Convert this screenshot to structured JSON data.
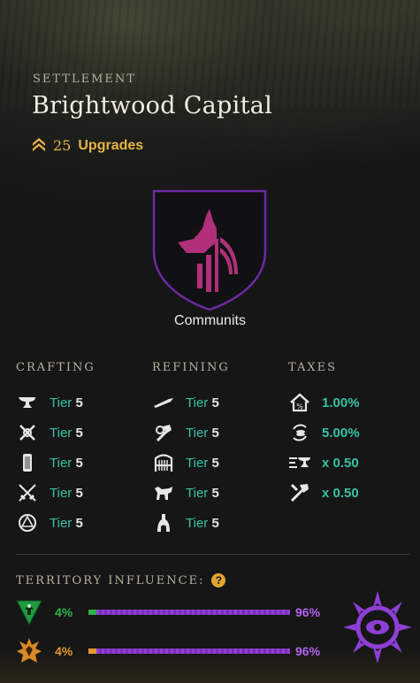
{
  "header": {
    "eyebrow": "SETTLEMENT",
    "title": "Brightwood Capital",
    "upgrades_count": "25",
    "upgrades_label": "Upgrades"
  },
  "company": {
    "name": "Communits"
  },
  "crafting": {
    "heading": "CRAFTING",
    "items": [
      {
        "icon": "anvil-icon",
        "tier_word": "Tier",
        "tier": "5"
      },
      {
        "icon": "crossed-tools-icon",
        "tier_word": "Tier",
        "tier": "5"
      },
      {
        "icon": "scroll-icon",
        "tier_word": "Tier",
        "tier": "5"
      },
      {
        "icon": "crossed-swords-icon",
        "tier_word": "Tier",
        "tier": "5"
      },
      {
        "icon": "arcane-circle-icon",
        "tier_word": "Tier",
        "tier": "5"
      }
    ]
  },
  "refining": {
    "heading": "REFINING",
    "items": [
      {
        "icon": "blade-icon",
        "tier_word": "Tier",
        "tier": "5"
      },
      {
        "icon": "hammer-icon",
        "tier_word": "Tier",
        "tier": "5"
      },
      {
        "icon": "loom-icon",
        "tier_word": "Tier",
        "tier": "5"
      },
      {
        "icon": "tanning-rack-icon",
        "tier_word": "Tier",
        "tier": "5"
      },
      {
        "icon": "kiln-icon",
        "tier_word": "Tier",
        "tier": "5"
      }
    ]
  },
  "taxes": {
    "heading": "TAXES",
    "items": [
      {
        "icon": "house-tax-icon",
        "value": "1.00%"
      },
      {
        "icon": "coin-cycle-icon",
        "value": "5.00%"
      },
      {
        "icon": "anvil-fee-icon",
        "value": "x 0.50"
      },
      {
        "icon": "tools-fee-icon",
        "value": "x 0.50"
      }
    ]
  },
  "territory": {
    "heading": "TERRITORY INFLUENCE:",
    "help": "?",
    "rows": [
      {
        "icon": "green-faction-icon",
        "left_pct": "4%",
        "right_pct": "96%",
        "left_value": 4,
        "left_color": "#2fb24a"
      },
      {
        "icon": "orange-faction-icon",
        "left_pct": "4%",
        "right_pct": "96%",
        "left_value": 4,
        "left_color": "#e3962c"
      }
    ],
    "owner_icon": "purple-faction-emblem-icon",
    "owner_color": "#8d3fd6"
  }
}
